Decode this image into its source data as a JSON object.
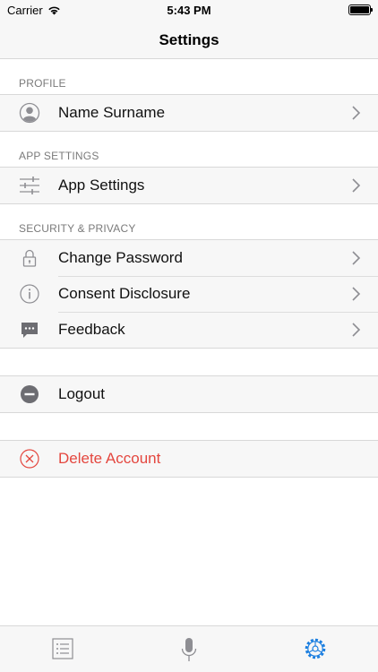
{
  "status_bar": {
    "carrier": "Carrier",
    "time": "5:43 PM",
    "battery_level": 1.0
  },
  "nav": {
    "title": "Settings"
  },
  "sections": {
    "profile": {
      "header": "PROFILE",
      "name": "Name Surname"
    },
    "app_settings": {
      "header": "APP SETTINGS",
      "app_settings_label": "App Settings"
    },
    "security": {
      "header": "SECURITY & PRIVACY",
      "change_password": "Change Password",
      "consent_disclosure": "Consent Disclosure",
      "feedback": "Feedback"
    }
  },
  "actions": {
    "logout": "Logout",
    "delete_account": "Delete Account"
  },
  "tabs": [
    "list-icon",
    "microphone-icon",
    "settings-gear-icon"
  ],
  "colors": {
    "accent": "#1a7ee0",
    "danger": "#e4473f",
    "icon_gray": "#8e8e93"
  }
}
